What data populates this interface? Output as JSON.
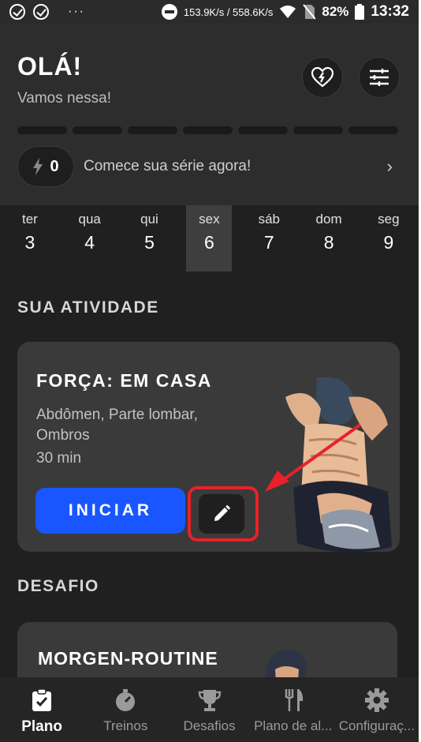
{
  "status_bar": {
    "network_speed": "153.9K/s / 558.6K/s",
    "battery": "82%",
    "time": "13:32"
  },
  "header": {
    "greeting": "OLÁ!",
    "subtitle": "Vamos nessa!",
    "streak_segments": 7,
    "streak_count": "0",
    "streak_text": "Comece sua série agora!"
  },
  "days": [
    {
      "name": "ter",
      "num": "3",
      "selected": false
    },
    {
      "name": "qua",
      "num": "4",
      "selected": false
    },
    {
      "name": "qui",
      "num": "5",
      "selected": false
    },
    {
      "name": "sex",
      "num": "6",
      "selected": true
    },
    {
      "name": "sáb",
      "num": "7",
      "selected": false
    },
    {
      "name": "dom",
      "num": "8",
      "selected": false
    },
    {
      "name": "seg",
      "num": "9",
      "selected": false
    }
  ],
  "activity": {
    "section_title": "SUA ATIVIDADE",
    "title": "FORÇA: EM CASA",
    "tags": "Abdômen, Parte lombar, Ombros",
    "duration": "30 min",
    "start_label": "INICIAR"
  },
  "challenge": {
    "section_title": "DESAFIO",
    "title": "MORGEN-ROUTINE"
  },
  "nav": [
    {
      "label": "Plano",
      "icon": "clipboard-check-icon",
      "active": true
    },
    {
      "label": "Treinos",
      "icon": "stopwatch-icon",
      "active": false
    },
    {
      "label": "Desafios",
      "icon": "trophy-icon",
      "active": false
    },
    {
      "label": "Plano de al...",
      "icon": "fork-knife-icon",
      "active": false
    },
    {
      "label": "Configuraç...",
      "icon": "gear-icon",
      "active": false
    }
  ],
  "colors": {
    "background": "#202020",
    "card": "#3a3a3a",
    "accent_blue": "#1a56ff",
    "highlight_red": "#e8212a"
  }
}
